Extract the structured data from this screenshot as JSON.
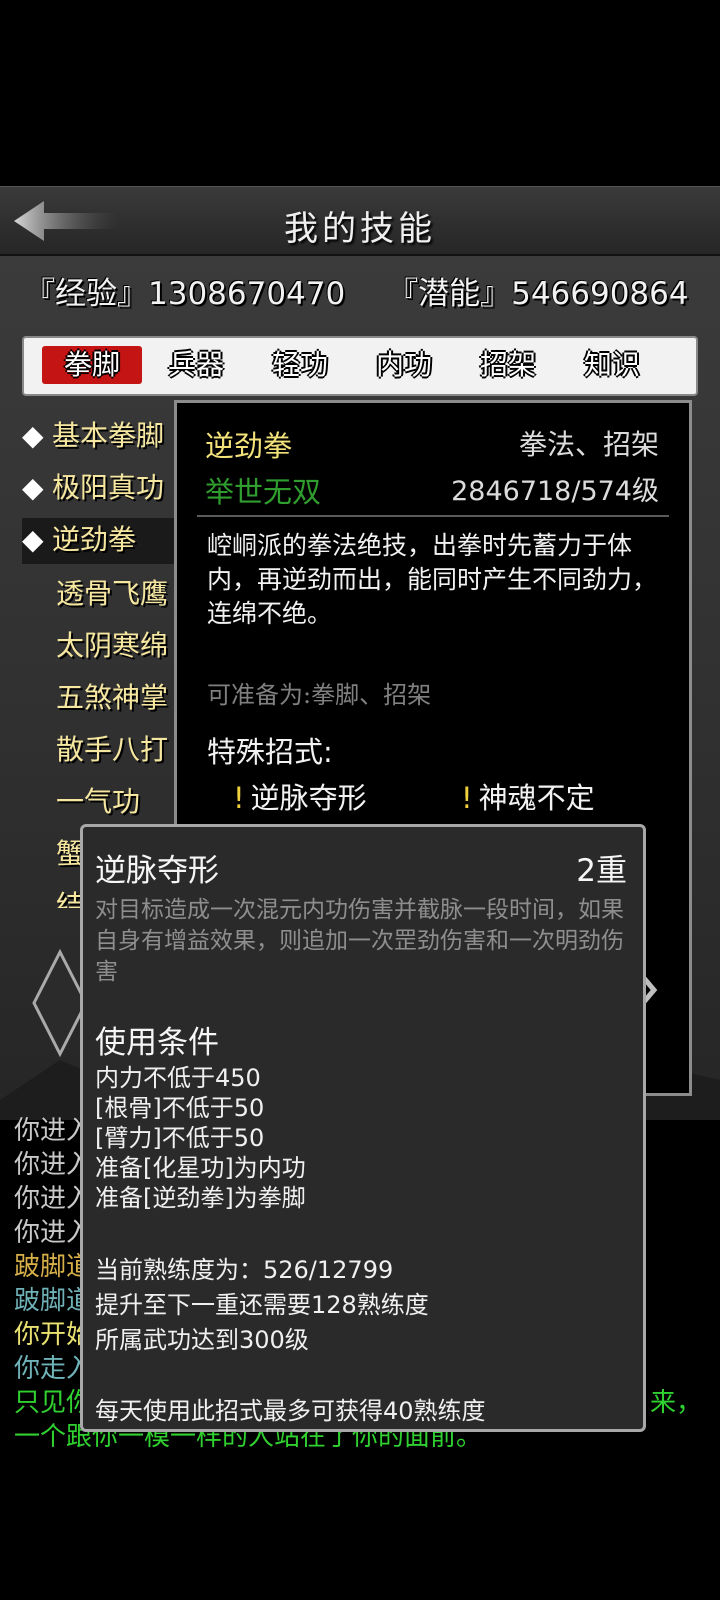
{
  "header": {
    "title": "我的技能",
    "back_label": "back"
  },
  "stats": {
    "experience": "『经验』1308670470",
    "potential": "『潜能』546690864"
  },
  "tabs": [
    {
      "label": "拳脚",
      "active": true
    },
    {
      "label": "兵器",
      "active": false
    },
    {
      "label": "轻功",
      "active": false
    },
    {
      "label": "内功",
      "active": false
    },
    {
      "label": "招架",
      "active": false
    },
    {
      "label": "知识",
      "active": false
    }
  ],
  "skills": [
    {
      "name": "基本拳脚",
      "bullet": true,
      "selected": false
    },
    {
      "name": "极阳真功",
      "bullet": true,
      "selected": false
    },
    {
      "name": "逆劲拳",
      "bullet": true,
      "selected": true
    },
    {
      "name": "透骨飞鹰",
      "bullet": false,
      "selected": false
    },
    {
      "name": "太阴寒绵",
      "bullet": false,
      "selected": false
    },
    {
      "name": "五煞神掌",
      "bullet": false,
      "selected": false
    },
    {
      "name": "散手八打",
      "bullet": false,
      "selected": false
    },
    {
      "name": "一气功",
      "bullet": false,
      "selected": false
    },
    {
      "name": "蟹",
      "bullet": false,
      "selected": false
    },
    {
      "name": "结",
      "bullet": false,
      "selected": false
    }
  ],
  "detail": {
    "name": "逆劲拳",
    "type": "拳法、招架",
    "rank": "举世无双",
    "level": "2846718/574级",
    "description": "崆峒派的拳法绝技，出拳时先蓄力于体内，再逆劲而出，能同时产生不同劲力，连绵不绝。",
    "prepare": "可准备为:拳脚、招架",
    "special_heading": "特殊招式:",
    "special_moves": [
      "逆脉夺形",
      "神魂不定"
    ],
    "move_mark": "!"
  },
  "popup": {
    "title": "逆脉夺形",
    "tier": "2重",
    "description": "对目标造成一次混元内功伤害并截脉一段时间，如果自身有增益效果，则追加一次罡劲伤害和一次明劲伤害",
    "conditions_heading": "使用条件",
    "conditions": [
      "内力不低于450",
      "[根骨]不低于50",
      "[臂力]不低于50",
      "准备[化星功]为内功",
      "准备[逆劲拳]为拳脚"
    ],
    "progress": [
      "当前熟练度为：526/12799",
      "提升至下一重还需要128熟练度",
      "所属武功达到300级"
    ],
    "daily": "每天使用此招式最多可获得40熟练度"
  },
  "log": [
    {
      "text": "你进入",
      "color": "#c8c8c8"
    },
    {
      "text": "你进入",
      "color": "#c8c8c8"
    },
    {
      "text": "你进入",
      "color": "#c8c8c8"
    },
    {
      "text": "你进入",
      "color": "#c8c8c8"
    },
    {
      "text": "跛脚道",
      "color": "#d8b04a"
    },
    {
      "text": "跛脚道",
      "color": "#6fb2b8"
    },
    {
      "text": "你开始",
      "color": "#e8e070"
    },
    {
      "text": "你走入",
      "color": "#6fb2b8"
    },
    {
      "text": "只见你",
      "color": "#2fd02f"
    },
    {
      "text": "一个跟你一模一样的人站在了你的面前。",
      "color": "#2fd02f"
    }
  ],
  "log_tail": "来，",
  "colors": {
    "accent_red": "#c41414",
    "gold": "#f3e27a",
    "green": "#2f9e2f"
  }
}
